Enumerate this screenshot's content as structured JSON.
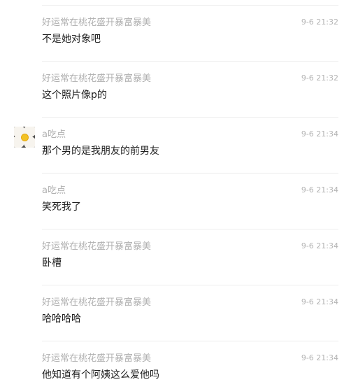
{
  "messages": [
    {
      "sender": "好运常在桃花盛开暴富暴美",
      "time": "9-6 21:32",
      "text": "不是她对象吧",
      "avatar": ""
    },
    {
      "sender": "好运常在桃花盛开暴富暴美",
      "time": "9-6 21:32",
      "text": "这个照片像p的",
      "avatar": ""
    },
    {
      "sender": "a吃点",
      "time": "9-6 21:34",
      "text": "那个男的是我朋友的前男友",
      "avatar": "white-flower-avatar"
    },
    {
      "sender": "a吃点",
      "time": "9-6 21:34",
      "text": "笑死我了",
      "avatar": ""
    },
    {
      "sender": "好运常在桃花盛开暴富暴美",
      "time": "9-6 21:34",
      "text": "卧槽",
      "avatar": ""
    },
    {
      "sender": "好运常在桃花盛开暴富暴美",
      "time": "9-6 21:34",
      "text": "哈哈哈哈",
      "avatar": ""
    },
    {
      "sender": "好运常在桃花盛开暴富暴美",
      "time": "9-6 21:34",
      "text": "他知道有个阿姨这么爱他吗",
      "avatar": ""
    }
  ]
}
